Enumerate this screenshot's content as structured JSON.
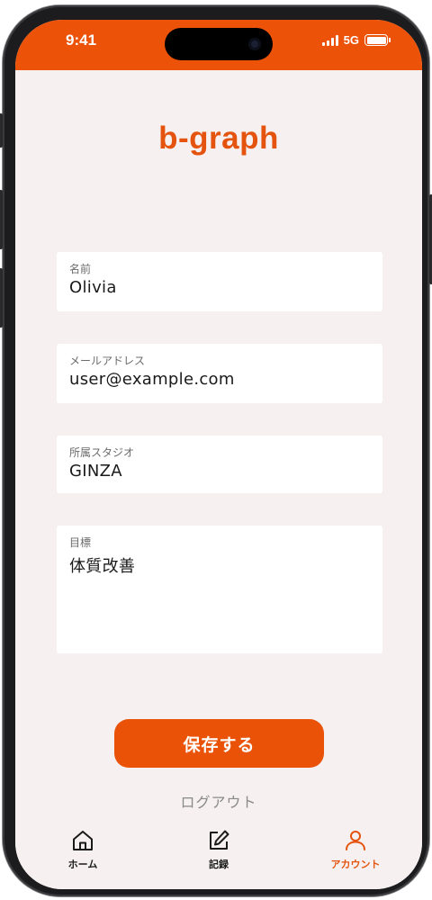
{
  "status_bar": {
    "time": "9:41",
    "network": "5G",
    "background": "#ec5208"
  },
  "app": {
    "logo_text": "b-graph",
    "accent_color": "#e4540e"
  },
  "form": {
    "name": {
      "label": "名前",
      "value": "Olivia"
    },
    "email": {
      "label": "メールアドレス",
      "value": "user@example.com"
    },
    "studio": {
      "label": "所属スタジオ",
      "value": "GINZA"
    },
    "goal": {
      "label": "目標",
      "value": "体質改善"
    }
  },
  "actions": {
    "save_label": "保存する",
    "logout_label": "ログアウト"
  },
  "tabbar": {
    "items": [
      {
        "label": "ホーム",
        "icon": "home-icon",
        "active": false
      },
      {
        "label": "記録",
        "icon": "edit-icon",
        "active": false
      },
      {
        "label": "アカウント",
        "icon": "user-icon",
        "active": true
      }
    ]
  }
}
